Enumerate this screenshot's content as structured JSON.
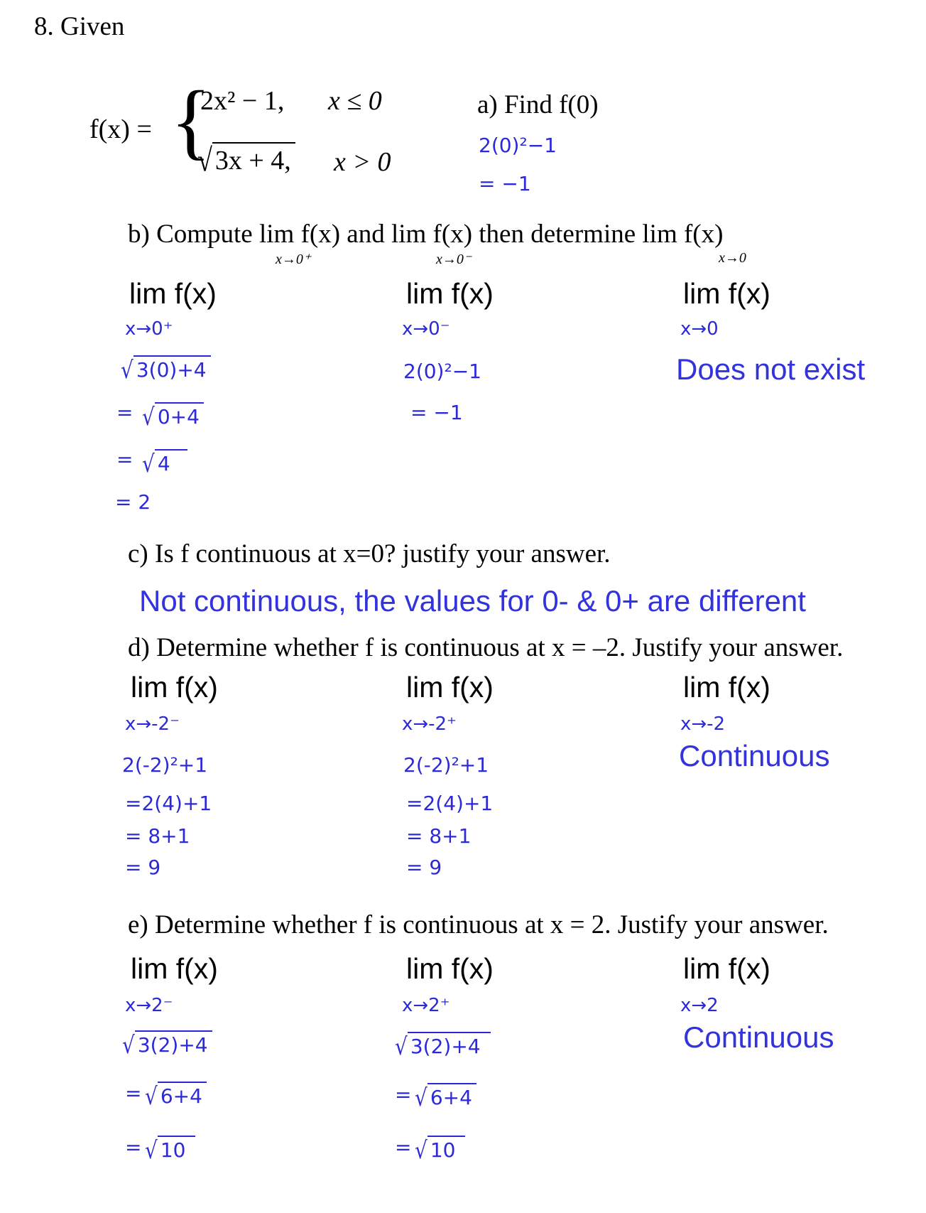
{
  "problem": {
    "number": "8. Given",
    "fx_label": "f(x) =",
    "piece1_expr": "2x² − 1,",
    "piece1_cond": "x ≤ 0",
    "piece2_expr": "3x + 4,",
    "piece2_cond": "x > 0"
  },
  "part_a": {
    "prompt": "a)  Find f(0)",
    "work1": "2(0)²−1",
    "work2": "= −1"
  },
  "part_b": {
    "prompt_pre": "b)  Compute lim f(x) and lim f(x) then determine lim f(x)",
    "sub1": "x→0⁺",
    "sub2": "x→0⁻",
    "sub3": "x→0",
    "col1": {
      "lim": "lim f(x)",
      "approach": "x→0⁺",
      "w1": "3(0)+4",
      "w2": "0+4",
      "w3": "4",
      "w4": "= 2"
    },
    "col2": {
      "lim": "lim f(x)",
      "approach": "x→0⁻",
      "w1": "2(0)²−1",
      "w2": "= −1"
    },
    "col3": {
      "lim": "lim f(x)",
      "approach": "x→0",
      "answer": "Does not exist"
    }
  },
  "part_c": {
    "prompt": "c)  Is f continuous at x=0? justify your answer.",
    "answer": "Not continuous, the values for 0- & 0+ are different"
  },
  "part_d": {
    "prompt": "d)  Determine whether f is continuous at x = –2. Justify your answer.",
    "col1": {
      "lim": "lim f(x)",
      "approach": "x→-2⁻",
      "w1": "2(-2)²+1",
      "w2": "=2(4)+1",
      "w3": "= 8+1",
      "w4": "= 9"
    },
    "col2": {
      "lim": "lim f(x)",
      "approach": "x→-2⁺",
      "w1": "2(-2)²+1",
      "w2": "=2(4)+1",
      "w3": "= 8+1",
      "w4": "= 9"
    },
    "col3": {
      "lim": "lim f(x)",
      "approach": "x→-2",
      "answer": "Continuous"
    }
  },
  "part_e": {
    "prompt": "e)  Determine whether f is continuous at x = 2. Justify your answer.",
    "col1": {
      "lim": "lim f(x)",
      "approach": "x→2⁻",
      "w1": "3(2)+4",
      "w2": "6+4",
      "w3": "10"
    },
    "col2": {
      "lim": "lim f(x)",
      "approach": "x→2⁺",
      "w1": "3(2)+4",
      "w2": "6+4",
      "w3": "10"
    },
    "col3": {
      "lim": "lim f(x)",
      "approach": "x→2",
      "answer": "Continuous"
    }
  },
  "symbols": {
    "equals": "="
  },
  "colors": {
    "ink": "#000000",
    "answer_blue": "#3333dd",
    "handwriting_blue": "#2b2ad6"
  }
}
